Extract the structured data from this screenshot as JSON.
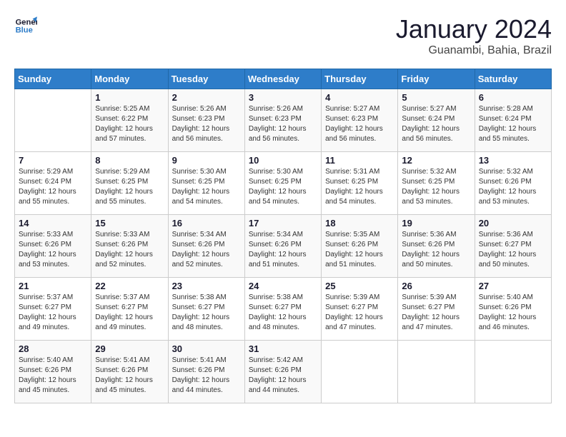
{
  "header": {
    "logo_line1": "General",
    "logo_line2": "Blue",
    "title": "January 2024",
    "subtitle": "Guanambi, Bahia, Brazil"
  },
  "days_of_week": [
    "Sunday",
    "Monday",
    "Tuesday",
    "Wednesday",
    "Thursday",
    "Friday",
    "Saturday"
  ],
  "weeks": [
    [
      {
        "day": "",
        "info": ""
      },
      {
        "day": "1",
        "info": "Sunrise: 5:25 AM\nSunset: 6:22 PM\nDaylight: 12 hours\nand 57 minutes."
      },
      {
        "day": "2",
        "info": "Sunrise: 5:26 AM\nSunset: 6:23 PM\nDaylight: 12 hours\nand 56 minutes."
      },
      {
        "day": "3",
        "info": "Sunrise: 5:26 AM\nSunset: 6:23 PM\nDaylight: 12 hours\nand 56 minutes."
      },
      {
        "day": "4",
        "info": "Sunrise: 5:27 AM\nSunset: 6:23 PM\nDaylight: 12 hours\nand 56 minutes."
      },
      {
        "day": "5",
        "info": "Sunrise: 5:27 AM\nSunset: 6:24 PM\nDaylight: 12 hours\nand 56 minutes."
      },
      {
        "day": "6",
        "info": "Sunrise: 5:28 AM\nSunset: 6:24 PM\nDaylight: 12 hours\nand 55 minutes."
      }
    ],
    [
      {
        "day": "7",
        "info": "Sunrise: 5:29 AM\nSunset: 6:24 PM\nDaylight: 12 hours\nand 55 minutes."
      },
      {
        "day": "8",
        "info": "Sunrise: 5:29 AM\nSunset: 6:25 PM\nDaylight: 12 hours\nand 55 minutes."
      },
      {
        "day": "9",
        "info": "Sunrise: 5:30 AM\nSunset: 6:25 PM\nDaylight: 12 hours\nand 54 minutes."
      },
      {
        "day": "10",
        "info": "Sunrise: 5:30 AM\nSunset: 6:25 PM\nDaylight: 12 hours\nand 54 minutes."
      },
      {
        "day": "11",
        "info": "Sunrise: 5:31 AM\nSunset: 6:25 PM\nDaylight: 12 hours\nand 54 minutes."
      },
      {
        "day": "12",
        "info": "Sunrise: 5:32 AM\nSunset: 6:25 PM\nDaylight: 12 hours\nand 53 minutes."
      },
      {
        "day": "13",
        "info": "Sunrise: 5:32 AM\nSunset: 6:26 PM\nDaylight: 12 hours\nand 53 minutes."
      }
    ],
    [
      {
        "day": "14",
        "info": "Sunrise: 5:33 AM\nSunset: 6:26 PM\nDaylight: 12 hours\nand 53 minutes."
      },
      {
        "day": "15",
        "info": "Sunrise: 5:33 AM\nSunset: 6:26 PM\nDaylight: 12 hours\nand 52 minutes."
      },
      {
        "day": "16",
        "info": "Sunrise: 5:34 AM\nSunset: 6:26 PM\nDaylight: 12 hours\nand 52 minutes."
      },
      {
        "day": "17",
        "info": "Sunrise: 5:34 AM\nSunset: 6:26 PM\nDaylight: 12 hours\nand 51 minutes."
      },
      {
        "day": "18",
        "info": "Sunrise: 5:35 AM\nSunset: 6:26 PM\nDaylight: 12 hours\nand 51 minutes."
      },
      {
        "day": "19",
        "info": "Sunrise: 5:36 AM\nSunset: 6:26 PM\nDaylight: 12 hours\nand 50 minutes."
      },
      {
        "day": "20",
        "info": "Sunrise: 5:36 AM\nSunset: 6:27 PM\nDaylight: 12 hours\nand 50 minutes."
      }
    ],
    [
      {
        "day": "21",
        "info": "Sunrise: 5:37 AM\nSunset: 6:27 PM\nDaylight: 12 hours\nand 49 minutes."
      },
      {
        "day": "22",
        "info": "Sunrise: 5:37 AM\nSunset: 6:27 PM\nDaylight: 12 hours\nand 49 minutes."
      },
      {
        "day": "23",
        "info": "Sunrise: 5:38 AM\nSunset: 6:27 PM\nDaylight: 12 hours\nand 48 minutes."
      },
      {
        "day": "24",
        "info": "Sunrise: 5:38 AM\nSunset: 6:27 PM\nDaylight: 12 hours\nand 48 minutes."
      },
      {
        "day": "25",
        "info": "Sunrise: 5:39 AM\nSunset: 6:27 PM\nDaylight: 12 hours\nand 47 minutes."
      },
      {
        "day": "26",
        "info": "Sunrise: 5:39 AM\nSunset: 6:27 PM\nDaylight: 12 hours\nand 47 minutes."
      },
      {
        "day": "27",
        "info": "Sunrise: 5:40 AM\nSunset: 6:26 PM\nDaylight: 12 hours\nand 46 minutes."
      }
    ],
    [
      {
        "day": "28",
        "info": "Sunrise: 5:40 AM\nSunset: 6:26 PM\nDaylight: 12 hours\nand 45 minutes."
      },
      {
        "day": "29",
        "info": "Sunrise: 5:41 AM\nSunset: 6:26 PM\nDaylight: 12 hours\nand 45 minutes."
      },
      {
        "day": "30",
        "info": "Sunrise: 5:41 AM\nSunset: 6:26 PM\nDaylight: 12 hours\nand 44 minutes."
      },
      {
        "day": "31",
        "info": "Sunrise: 5:42 AM\nSunset: 6:26 PM\nDaylight: 12 hours\nand 44 minutes."
      },
      {
        "day": "",
        "info": ""
      },
      {
        "day": "",
        "info": ""
      },
      {
        "day": "",
        "info": ""
      }
    ]
  ]
}
